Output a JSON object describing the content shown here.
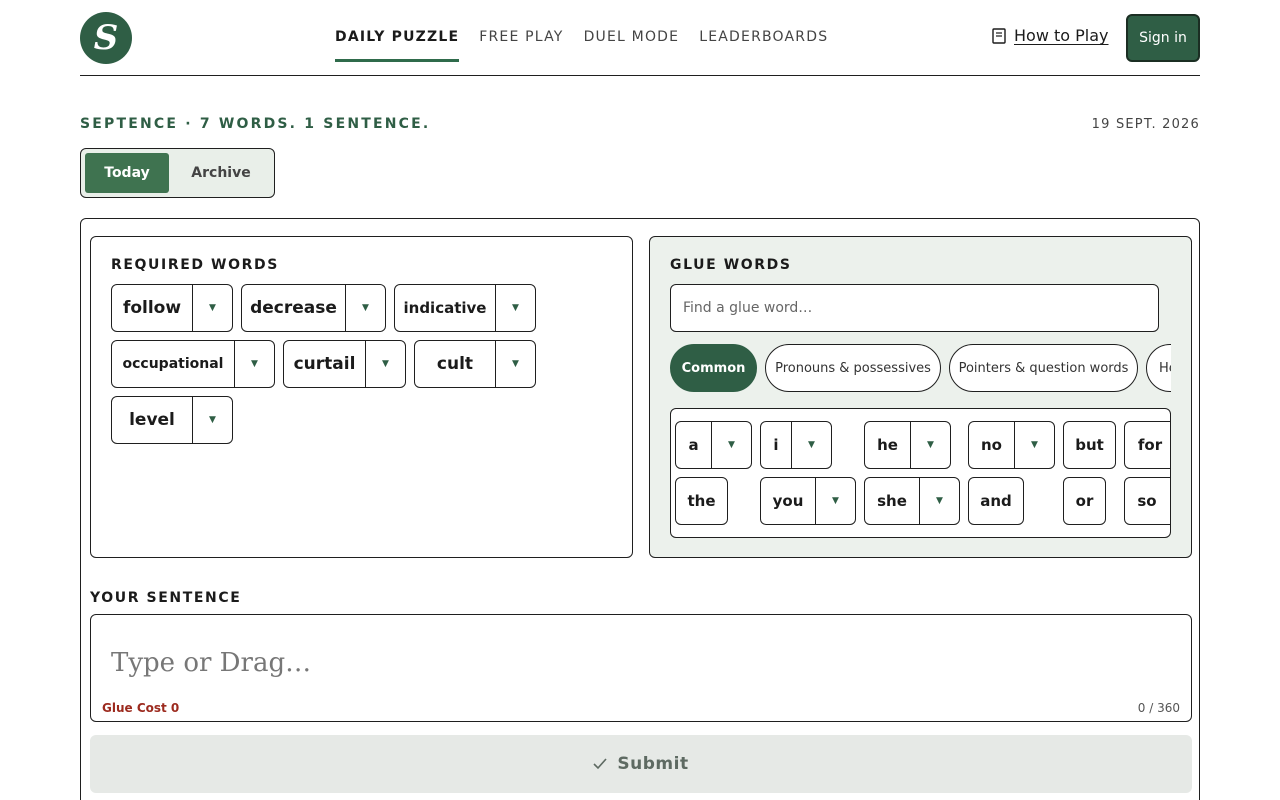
{
  "header": {
    "logo_text": "S",
    "nav": [
      "DAILY PUZZLE",
      "FREE PLAY",
      "DUEL MODE",
      "LEADERBOARDS"
    ],
    "active_nav": "DAILY PUZZLE",
    "how_to_play": "How to Play",
    "sign_in": "Sign in"
  },
  "subheader": {
    "tagline": "SEPTENCE · 7 WORDS. 1 SENTENCE.",
    "date": "19 SEPT. 2026",
    "tabs": [
      "Today",
      "Archive"
    ],
    "active_tab": "Today"
  },
  "required": {
    "title": "REQUIRED WORDS",
    "words": [
      "follow",
      "decrease",
      "indicative",
      "occupational",
      "curtail",
      "cult",
      "level"
    ]
  },
  "glue": {
    "title": "GLUE WORDS",
    "search_placeholder": "Find a glue word…",
    "categories": [
      "Common",
      "Pronouns & possessives",
      "Pointers & question words",
      "He"
    ],
    "active_category": "Common",
    "words": [
      "a",
      "i",
      "he",
      "no",
      "but",
      "for",
      "the",
      "you",
      "she",
      "and",
      "or",
      "so"
    ]
  },
  "sentence": {
    "title": "YOUR SENTENCE",
    "placeholder": "Type or Drag…",
    "glue_cost": "Glue Cost 0",
    "char_count": "0 / 360"
  },
  "submit": {
    "label": "Submit"
  },
  "colors": {
    "brand": "#2f5e45",
    "accent": "#3f7350",
    "panel_bg": "#ecf1ec",
    "error": "#9c2a1e"
  }
}
